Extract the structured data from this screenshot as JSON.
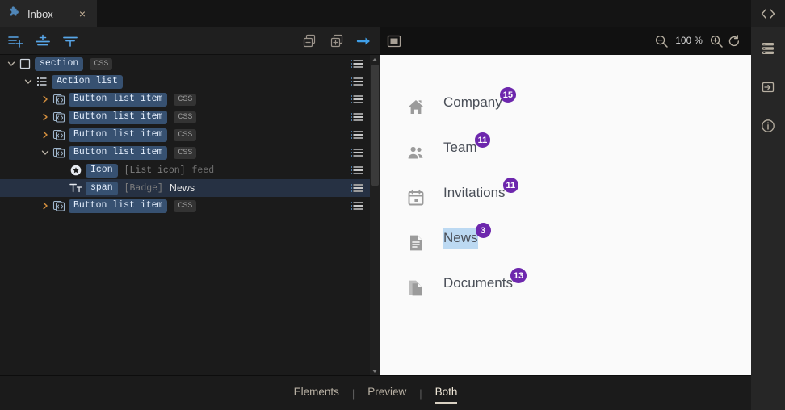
{
  "window": {
    "tab": {
      "title": "Inbox",
      "icon": "puzzle-piece-icon",
      "close_label": "×"
    },
    "code_toggle_icon": "code-brackets-icon"
  },
  "right_rail": {
    "items": [
      {
        "name": "layers-list-icon",
        "label": "Layers"
      },
      {
        "name": "import-box-arrow-icon",
        "label": "Import"
      },
      {
        "name": "info-circle-icon",
        "label": "Info"
      }
    ]
  },
  "elements_panel": {
    "toolbar": {
      "left_buttons": [
        {
          "name": "add-list-item-icon",
          "label": "Add element"
        },
        {
          "name": "insert-between-icon",
          "label": "Insert between"
        },
        {
          "name": "align-distribute-icon",
          "label": "Align"
        }
      ],
      "right_buttons": [
        {
          "name": "collapse-all-icon",
          "label": "Collapse all"
        },
        {
          "name": "expand-all-icon",
          "label": "Expand all"
        },
        {
          "name": "jump-to-icon",
          "label": "Go to element"
        }
      ]
    },
    "tree": [
      {
        "indent": 0,
        "twisty": "down",
        "icon": "square-outline-icon",
        "tag": "section",
        "css": "CSS",
        "meta": "",
        "value": "",
        "selected": false,
        "menu": "row-menu-icon"
      },
      {
        "indent": 1,
        "twisty": "down",
        "icon": "list-icon",
        "tag": "Action list",
        "css": "",
        "meta": "",
        "value": "",
        "selected": false,
        "menu": "row-menu-icon"
      },
      {
        "indent": 2,
        "twisty": "right",
        "icon": "component-code-icon",
        "tag": "Button list item",
        "css": "CSS",
        "meta": "",
        "value": "",
        "selected": false,
        "menu": "row-menu-icon"
      },
      {
        "indent": 2,
        "twisty": "right",
        "icon": "component-code-icon",
        "tag": "Button list item",
        "css": "CSS",
        "meta": "",
        "value": "",
        "selected": false,
        "menu": "row-menu-icon"
      },
      {
        "indent": 2,
        "twisty": "right",
        "icon": "component-code-icon",
        "tag": "Button list item",
        "css": "CSS",
        "meta": "",
        "value": "",
        "selected": false,
        "menu": "row-menu-icon"
      },
      {
        "indent": 2,
        "twisty": "down",
        "icon": "component-code-icon",
        "tag": "Button list item",
        "css": "CSS",
        "meta": "",
        "value": "",
        "selected": false,
        "menu": "row-menu-icon"
      },
      {
        "indent": 3,
        "twisty": "none",
        "icon": "star-circle-icon",
        "tag": "Icon",
        "css": "",
        "meta": "[List icon]",
        "value2": "feed",
        "value": "",
        "selected": false,
        "menu": "row-menu-icon"
      },
      {
        "indent": 3,
        "twisty": "none",
        "icon": "text-tt-icon",
        "tag": "span",
        "css": "",
        "meta": "[Badge]",
        "value": "News",
        "selected": true,
        "menu": "row-menu-icon"
      },
      {
        "indent": 2,
        "twisty": "right",
        "icon": "component-code-icon",
        "tag": "Button list item",
        "css": "CSS",
        "meta": "",
        "value": "",
        "selected": false,
        "menu": "row-menu-icon"
      }
    ]
  },
  "preview_panel": {
    "toolbar": {
      "frame_icon": "viewport-frame-icon",
      "zoom_out_icon": "zoom-out-icon",
      "zoom_level": "100 %",
      "zoom_in_icon": "zoom-in-icon",
      "refresh_icon": "refresh-icon"
    },
    "nav_items": [
      {
        "icon": "home-icon",
        "label": "Company",
        "badge": "15",
        "selected": false
      },
      {
        "icon": "people-icon",
        "label": "Team",
        "badge": "11",
        "selected": false
      },
      {
        "icon": "calendar-icon",
        "label": "Invitations",
        "badge": "11",
        "selected": false
      },
      {
        "icon": "article-icon",
        "label": "News",
        "badge": "3",
        "selected": true
      },
      {
        "icon": "copy-docs-icon",
        "label": "Documents",
        "badge": "13",
        "selected": false
      }
    ]
  },
  "bottom_tabs": {
    "items": [
      {
        "label": "Elements",
        "active": false
      },
      {
        "label": "Preview",
        "active": false
      },
      {
        "label": "Both",
        "active": true
      }
    ],
    "separator": "|"
  },
  "colors": {
    "badge_purple": "#6d27ad",
    "selection_blue": "#bcd9f2",
    "tag_pill": "#375171",
    "row_selected": "#263143",
    "accent_blue": "#4f9ede",
    "twisty_amber": "#d7913f",
    "preview_bg": "#fafafa"
  }
}
